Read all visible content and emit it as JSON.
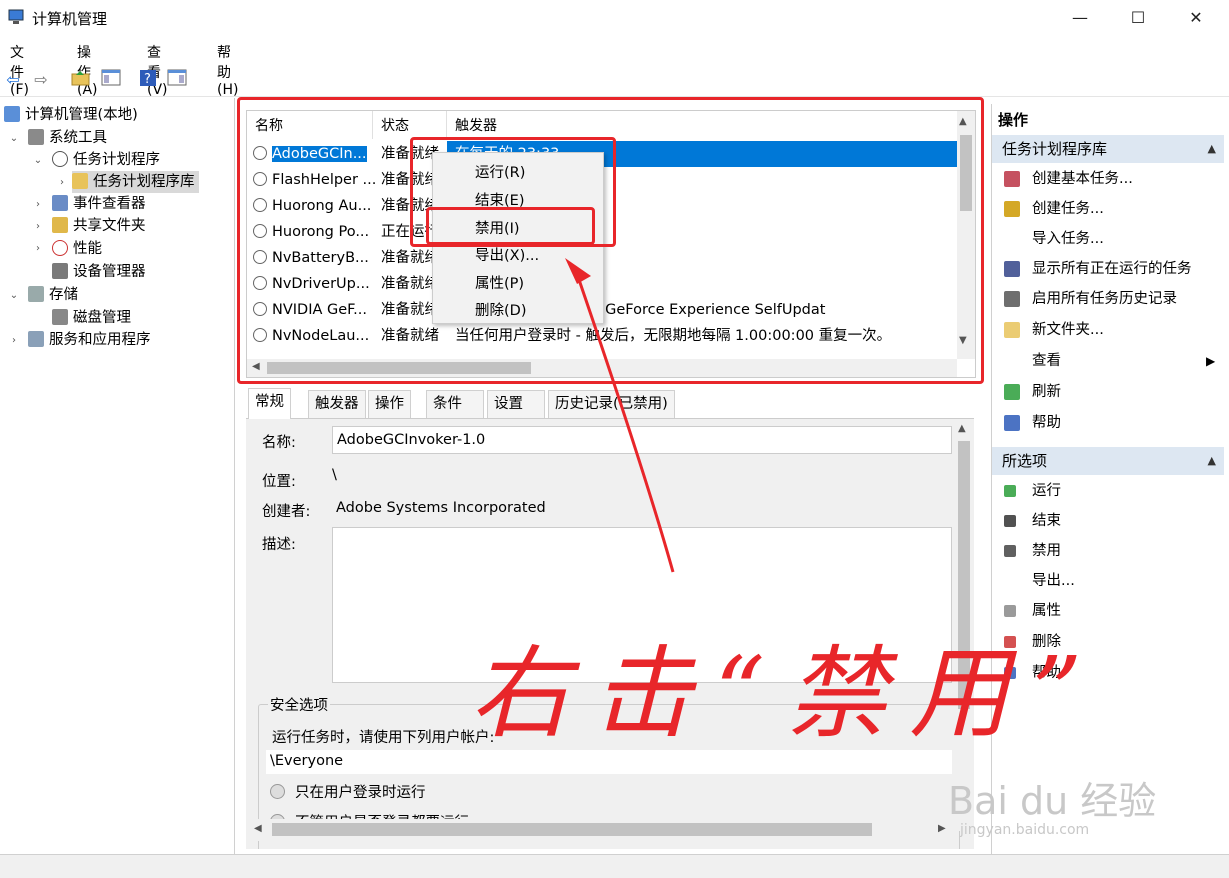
{
  "window": {
    "title": "计算机管理",
    "minimize": "—",
    "maximize": "☐",
    "close": "✕"
  },
  "menu": [
    "文件(F)",
    "操作(A)",
    "查看(V)",
    "帮助(H)"
  ],
  "toolbar": {
    "back": "⇦",
    "forward": "⇨",
    "help": "?"
  },
  "tree": {
    "root": "计算机管理(本地)",
    "system_tools": "系统工具",
    "task_scheduler": "任务计划程序",
    "task_library": "任务计划程序库",
    "event_viewer": "事件查看器",
    "shared_folders": "共享文件夹",
    "performance": "性能",
    "device_manager": "设备管理器",
    "storage": "存储",
    "disk_mgmt": "磁盘管理",
    "services_apps": "服务和应用程序"
  },
  "list": {
    "headers": [
      "名称",
      "状态",
      "触发器"
    ],
    "rows": [
      {
        "name": "AdobeGCIn...",
        "status": "准备就绪",
        "trigger": "在每天的 23:33"
      },
      {
        "name": "FlashHelper ...",
        "status": "准备就绪",
        "trigger": ""
      },
      {
        "name": "Huorong Au...",
        "status": "准备就绪",
        "trigger": ""
      },
      {
        "name": "Huorong Po...",
        "status": "正在运行",
        "trigger": ""
      },
      {
        "name": "NvBatteryB...",
        "status": "准备就绪",
        "trigger": ""
      },
      {
        "name": "NvDriverUp...",
        "status": "准备就绪",
        "trigger": ""
      },
      {
        "name": "NVIDIA GeF...",
        "status": "准备就绪",
        "trigger": "plication, 源: NVIDIA GeForce Experience SelfUpdat"
      },
      {
        "name": "NvNodeLau...",
        "status": "准备就绪",
        "trigger": "当任何用户登录时 - 触发后，无限期地每隔 1.00:00:00 重复一次。"
      }
    ]
  },
  "context_menu": [
    "运行(R)",
    "结束(E)",
    "禁用(I)",
    "导出(X)...",
    "属性(P)",
    "删除(D)"
  ],
  "tabs": [
    "常规",
    "触发器",
    "操作",
    "条件",
    "设置",
    "历史记录(已禁用)"
  ],
  "details": {
    "name_label": "名称:",
    "name_value": "AdobeGCInvoker-1.0",
    "location_label": "位置:",
    "location_value": "\\",
    "author_label": "创建者:",
    "author_value": "Adobe Systems Incorporated",
    "desc_label": "描述:",
    "security_title": "安全选项",
    "run_as_label": "运行任务时，请使用下列用户帐户:",
    "run_as_value": "\\Everyone",
    "radio1": "只在用户登录时运行",
    "radio2": "不管用户是否登录都要运行"
  },
  "actions": {
    "title": "操作",
    "section1": "任务计划程序库",
    "items1": [
      "创建基本任务...",
      "创建任务...",
      "导入任务...",
      "显示所有正在运行的任务",
      "启用所有任务历史记录",
      "新文件夹...",
      "查看",
      "刷新",
      "帮助"
    ],
    "section2": "所选项",
    "items2": [
      "运行",
      "结束",
      "禁用",
      "导出...",
      "属性",
      "删除",
      "帮助"
    ]
  },
  "annotation": "右击“禁用”",
  "watermark": {
    "logo": "Bai du 经验",
    "url": "jingyan.baidu.com"
  },
  "colors": {
    "accent": "#0078d7",
    "annotation_red": "#e8262a",
    "section_bg": "#dde7f2"
  }
}
